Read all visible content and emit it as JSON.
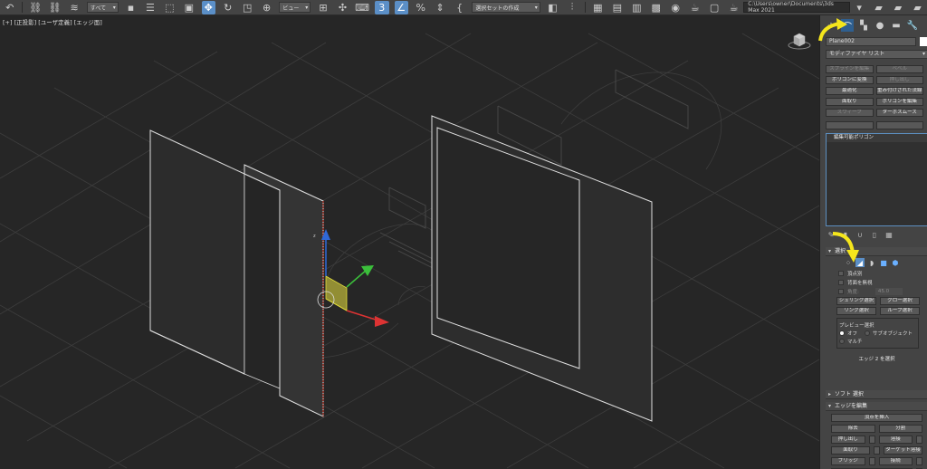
{
  "toolbar": {
    "selection_filter": "すべて",
    "view_label": "ビュー",
    "named_selection": "選択セットの作成",
    "project_path": "C:\\Users\\owner\\Documents\\3ds Max 2021"
  },
  "viewport": {
    "label": "[+] [正投影] [ユーザ定義] [エッジ面]"
  },
  "panel": {
    "object_name": "Plane002",
    "modifier_list": "モディファイヤ リスト",
    "buttons": [
      {
        "label": "スプラインを編集",
        "enabled": false
      },
      {
        "label": "ベベル",
        "enabled": false
      },
      {
        "label": "ポリゴンに変換",
        "enabled": true
      },
      {
        "label": "押し出し",
        "enabled": false
      },
      {
        "label": "最適化",
        "enabled": true
      },
      {
        "label": "重み付けされた法線",
        "enabled": true
      },
      {
        "label": "面取り",
        "enabled": true
      },
      {
        "label": "ポリゴンを編集",
        "enabled": true
      },
      {
        "label": "スウィープ",
        "enabled": false
      },
      {
        "label": "ターボスムーズ",
        "enabled": true
      }
    ],
    "stack_item": "編集可能ポリゴン",
    "selection": {
      "title": "選択",
      "by_vertex": "頂点別",
      "ignore_backfacing": "背面を無視",
      "by_angle": "角度:",
      "angle_value": "45.0",
      "shrink": "シュリンク選択",
      "grow": "グロー選択",
      "ring": "リング選択",
      "loop": "ループ選択",
      "preview_label": "プレビュー選択",
      "preview_off": "オフ",
      "preview_subobject": "サブオブジェクト",
      "preview_multi": "マルチ",
      "edge_count": "エッジ 2 を選択"
    },
    "soft_selection": "ソフト 選択",
    "edit_edges": {
      "title": "エッジを編集",
      "insert_vertex": "頂点を挿入",
      "remove": "除去",
      "split": "分割",
      "extrude": "押し出し",
      "weld": "溶接",
      "chamfer": "面取り",
      "target_weld": "ターゲット溶接",
      "bridge": "ブリッジ",
      "connect": "接続",
      "create_shape": "選択からシェイプを作成"
    }
  },
  "colors": {
    "accent": "#5b8fc7",
    "highlight_arrow": "#f5e61c"
  }
}
